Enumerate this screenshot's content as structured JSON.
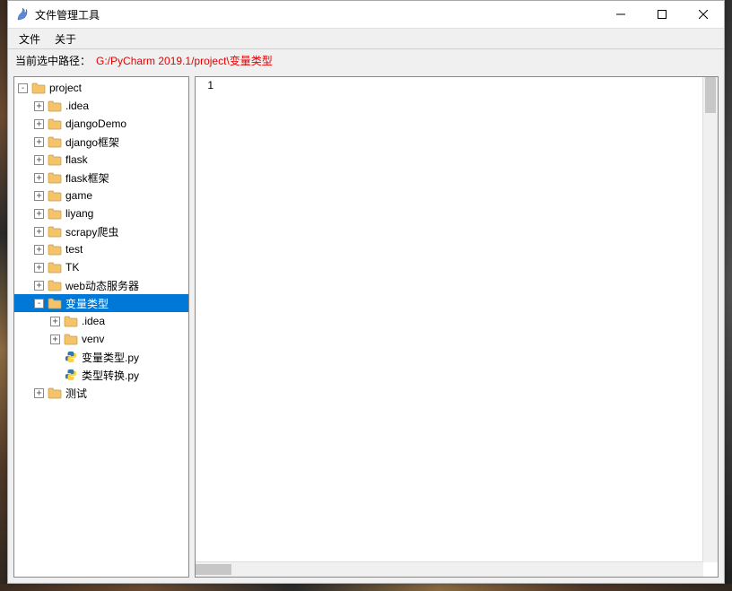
{
  "window": {
    "title": "文件管理工具"
  },
  "menu": {
    "file": "文件",
    "about": "关于"
  },
  "pathbar": {
    "label": "当前选中路径：",
    "path": "G:/PyCharm 2019.1/project\\变量类型"
  },
  "editor": {
    "line_numbers": [
      "1"
    ],
    "content": ""
  },
  "icons": {
    "folder_fill": "#f5c36a",
    "folder_stroke": "#c79a3a",
    "py_fill": "#3776ab"
  },
  "tree": [
    {
      "id": "project",
      "label": "project",
      "type": "folder",
      "depth": 0,
      "expander": "minus",
      "selected": false,
      "children": [
        {
          "id": "idea",
          "label": ".idea",
          "type": "folder",
          "depth": 1,
          "expander": "plus"
        },
        {
          "id": "djangoDemo",
          "label": "djangoDemo",
          "type": "folder",
          "depth": 1,
          "expander": "plus"
        },
        {
          "id": "djangoframe",
          "label": "django框架",
          "type": "folder",
          "depth": 1,
          "expander": "plus"
        },
        {
          "id": "flask",
          "label": "flask",
          "type": "folder",
          "depth": 1,
          "expander": "plus"
        },
        {
          "id": "flaskframe",
          "label": "flask框架",
          "type": "folder",
          "depth": 1,
          "expander": "plus"
        },
        {
          "id": "game",
          "label": "game",
          "type": "folder",
          "depth": 1,
          "expander": "plus"
        },
        {
          "id": "liyang",
          "label": "liyang",
          "type": "folder",
          "depth": 1,
          "expander": "plus"
        },
        {
          "id": "scrapy",
          "label": "scrapy爬虫",
          "type": "folder",
          "depth": 1,
          "expander": "plus"
        },
        {
          "id": "test",
          "label": "test",
          "type": "folder",
          "depth": 1,
          "expander": "plus"
        },
        {
          "id": "tk",
          "label": "TK",
          "type": "folder",
          "depth": 1,
          "expander": "plus"
        },
        {
          "id": "webdyn",
          "label": "web动态服务器",
          "type": "folder",
          "depth": 1,
          "expander": "plus"
        },
        {
          "id": "vartype",
          "label": "变量类型",
          "type": "folder",
          "depth": 1,
          "expander": "minus",
          "selected": true,
          "children": [
            {
              "id": "vt-idea",
              "label": ".idea",
              "type": "folder",
              "depth": 2,
              "expander": "plus"
            },
            {
              "id": "vt-venv",
              "label": "venv",
              "type": "folder",
              "depth": 2,
              "expander": "plus"
            },
            {
              "id": "vt-file1",
              "label": "变量类型.py",
              "type": "python",
              "depth": 2,
              "expander": "none"
            },
            {
              "id": "vt-file2",
              "label": "类型转换.py",
              "type": "python",
              "depth": 2,
              "expander": "none"
            }
          ]
        },
        {
          "id": "cetest",
          "label": "测试",
          "type": "folder",
          "depth": 1,
          "expander": "plus"
        }
      ]
    }
  ]
}
